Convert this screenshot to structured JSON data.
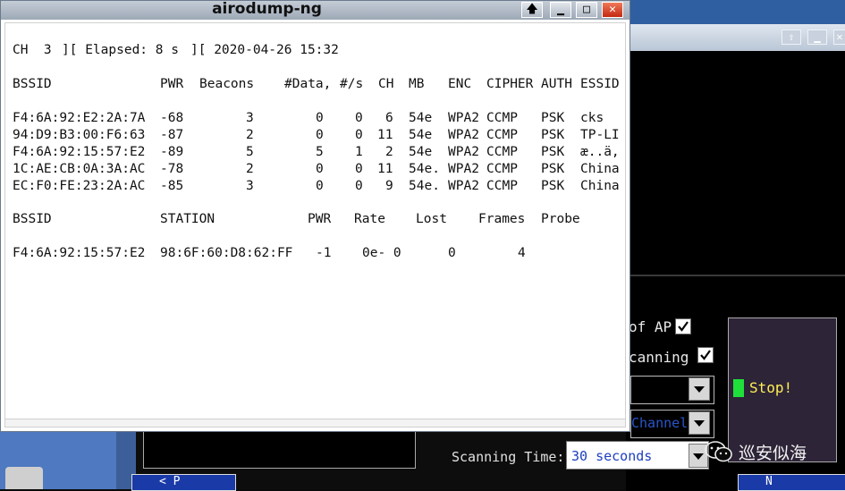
{
  "airodump": {
    "title": "airodump-ng",
    "status_line": {
      "channel": "CH  3",
      "elapsed": "][ Elapsed: 8 s",
      "datetime": "][ 2020-04-26 15:32"
    },
    "ap_headers": [
      "BSSID",
      "PWR",
      "Beacons",
      "#Data,",
      "#/s",
      "CH",
      "MB",
      "ENC",
      "CIPHER",
      "AUTH",
      "ESSID"
    ],
    "ap_rows": [
      {
        "bssid": "F4:6A:92:E2:2A:7A",
        "pwr": "-68",
        "beacons": "3",
        "data": "0",
        "ps": "0",
        "ch": "6",
        "mb": "54e",
        "enc": "WPA2",
        "cipher": "CCMP",
        "auth": "PSK",
        "essid": "cks"
      },
      {
        "bssid": "94:D9:B3:00:F6:63",
        "pwr": "-87",
        "beacons": "2",
        "data": "0",
        "ps": "0",
        "ch": "11",
        "mb": "54e",
        "enc": "WPA2",
        "cipher": "CCMP",
        "auth": "PSK",
        "essid": "TP-LI"
      },
      {
        "bssid": "F4:6A:92:15:57:E2",
        "pwr": "-89",
        "beacons": "5",
        "data": "5",
        "ps": "1",
        "ch": "2",
        "mb": "54e",
        "enc": "WPA2",
        "cipher": "CCMP",
        "auth": "PSK",
        "essid": "æ..ä,"
      },
      {
        "bssid": "1C:AE:CB:0A:3A:AC",
        "pwr": "-78",
        "beacons": "2",
        "data": "0",
        "ps": "0",
        "ch": "11",
        "mb": "54e.",
        "enc": "WPA2",
        "cipher": "CCMP",
        "auth": "PSK",
        "essid": "China"
      },
      {
        "bssid": "EC:F0:FE:23:2A:AC",
        "pwr": "-85",
        "beacons": "3",
        "data": "0",
        "ps": "0",
        "ch": "9",
        "mb": "54e.",
        "enc": "WPA2",
        "cipher": "CCMP",
        "auth": "PSK",
        "essid": "China"
      }
    ],
    "station_headers": [
      "BSSID",
      "STATION",
      "PWR",
      "Rate",
      "Lost",
      "Frames",
      "Probe"
    ],
    "station_rows": [
      {
        "bssid": "F4:6A:92:15:57:E2",
        "station": "98:6F:60:D8:62:FF",
        "pwr": "-1",
        "rate": "0e- 0",
        "lost": "0",
        "frames": "4",
        "probe": ""
      }
    ]
  },
  "background_app": {
    "option_1_label": "of AP",
    "option_1_checked": true,
    "option_2_label": "canning",
    "option_2_checked": true,
    "channel_select_value": "Channel",
    "stop_label": "Stop!",
    "scanning_time_label": "Scanning Time:",
    "scanning_time_value": "30 seconds",
    "prev_label": "< P",
    "next_label": "N"
  },
  "watermark": {
    "text": "巡安似海",
    "icon": "wechat-icon"
  },
  "colors": {
    "titlebar": "#b1bac6",
    "close_button": "#d8402a",
    "stop_led": "#1fe03a",
    "stop_text": "#ffee55",
    "scan_value": "#1d3fbe",
    "desktop_blue": "#2f5fa0"
  }
}
